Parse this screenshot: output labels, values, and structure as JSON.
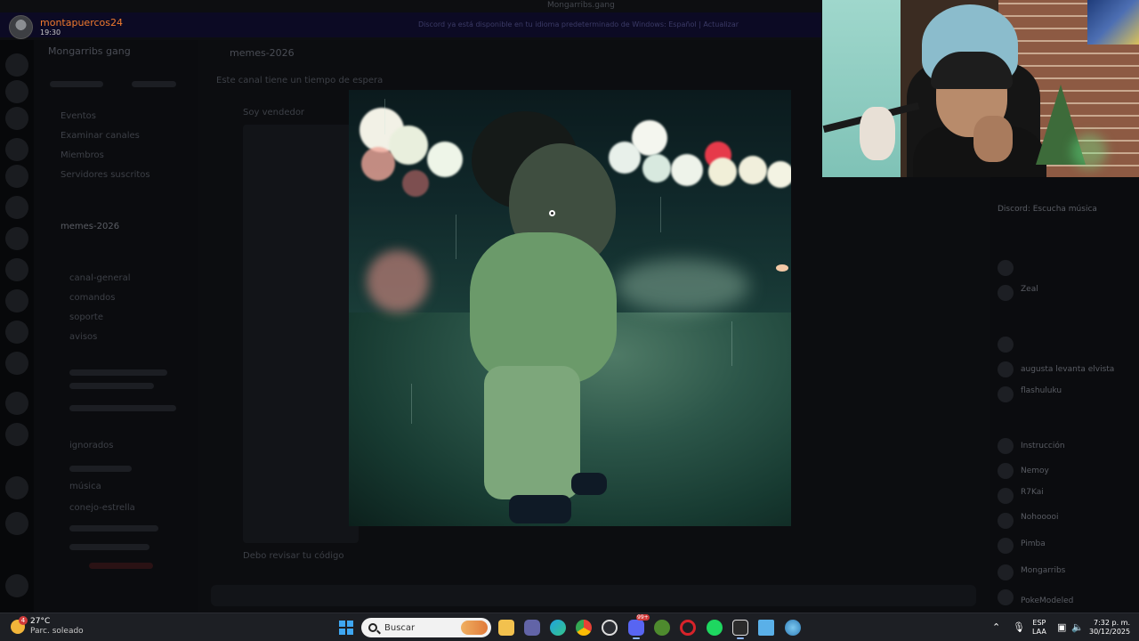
{
  "window": {
    "title": "Mongarribs.gang",
    "banner": "Discord ya está disponible en tu idioma predeterminado de Windows: Español | Actualizar"
  },
  "viewer": {
    "username": "montapuercos24",
    "time": "19:30"
  },
  "discord": {
    "server_name": "Mongarribs gang",
    "channel_name": "memes-2026",
    "chat_hint": "Este canal tiene un tiempo de espera",
    "chat_label": "Soy vendedor",
    "chat_footer": "Debo revisar tu código",
    "channel_items": [
      "Eventos",
      "Examinar canales",
      "Miembros",
      "Servidores suscritos",
      "memes-2026",
      "canal-general",
      "comandos",
      "soporte",
      "avisos",
      "ignorados",
      "música",
      "conejo-estrella"
    ],
    "member_labels": [
      "Discord: Escucha música",
      "Zeal",
      "augusta levanta elvista",
      "flashuluku",
      "Instrucción",
      "Nemoy",
      "R7Kai",
      "Nohooooi",
      "Pimba",
      "Mongarribs",
      "PokeModeled"
    ]
  },
  "taskbar": {
    "weather_temp": "27°C",
    "weather_desc": "Parc. soleado",
    "weather_badge": "4",
    "search_placeholder": "Buscar",
    "lang_top": "ESP",
    "lang_bottom": "LAA",
    "time": "7:32 p. m.",
    "date": "30/12/2025",
    "icons": [
      "file-explorer-icon",
      "teams-icon",
      "edge-icon",
      "chrome-icon",
      "github-desktop-icon",
      "discord-icon",
      "xbox-icon",
      "opera-gx-icon",
      "spotify-icon",
      "epic-games-icon",
      "notepad-icon",
      "globe-icon"
    ],
    "discord_badge": "99+"
  },
  "colors": {
    "username": "#f07a2e",
    "taskbar_bg": "#1d1f24",
    "start_blue": "#3fa7f2"
  }
}
